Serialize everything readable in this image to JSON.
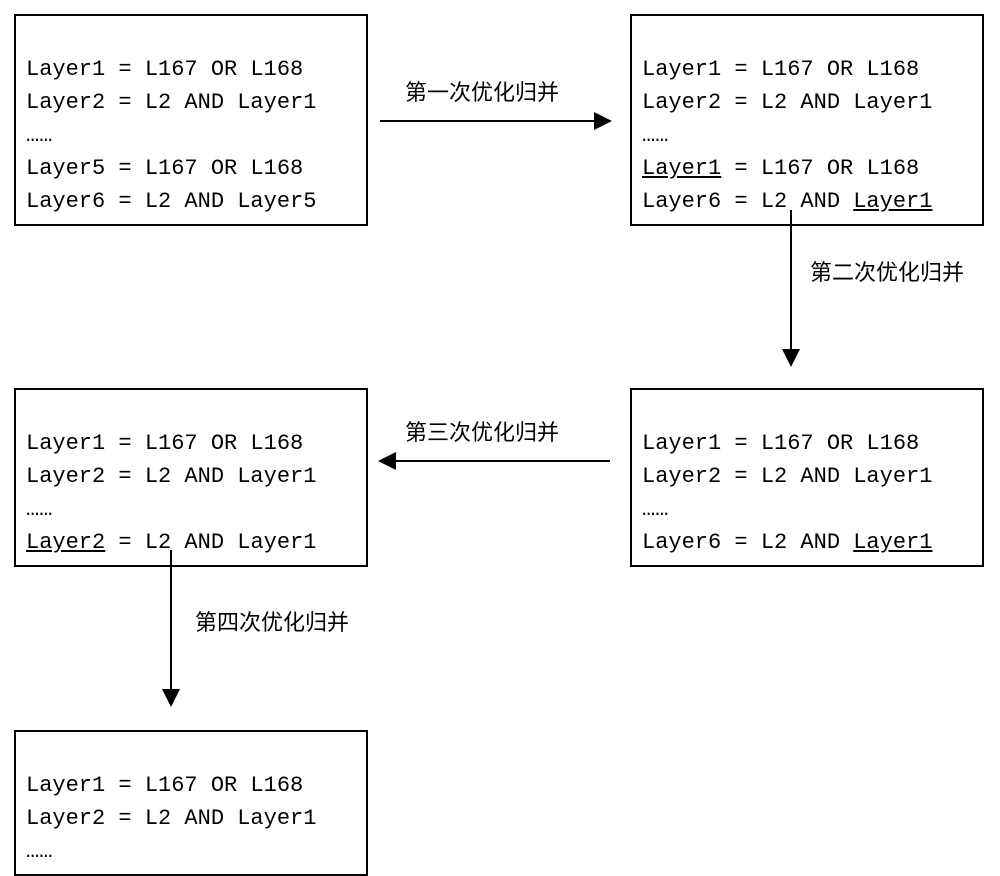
{
  "boxes": {
    "b1": {
      "l1": "Layer1 = L167 OR L168",
      "l2": "Layer2 = L2 AND Layer1",
      "l3": "……",
      "l4": "Layer5 = L167 OR L168",
      "l5": "Layer6 = L2 AND Layer5"
    },
    "b2": {
      "l1": "Layer1 = L167 OR L168",
      "l2": "Layer2 = L2 AND Layer1",
      "l3": "……",
      "l4a": "Layer1",
      "l4b": " = L167 OR L168",
      "l5a": "Layer6 = L2 AND ",
      "l5b": "Layer1"
    },
    "b3": {
      "l1": "Layer1 = L167 OR L168",
      "l2": "Layer2 = L2 AND Layer1",
      "l3": "……",
      "l4a": "Layer6 = L2 AND ",
      "l4b": "Layer1"
    },
    "b4": {
      "l1": "Layer1 = L167 OR L168",
      "l2": "Layer2 = L2 AND Layer1",
      "l3": "……",
      "l4a": "Layer2",
      "l4b": " = L2 AND Layer1"
    },
    "b5": {
      "l1": "Layer1 = L167 OR L168",
      "l2": "Layer2 = L2 AND Layer1",
      "l3": "……"
    }
  },
  "labels": {
    "a1": "第一次优化归并",
    "a2": "第二次优化归并",
    "a3": "第三次优化归并",
    "a4": "第四次优化归并"
  }
}
